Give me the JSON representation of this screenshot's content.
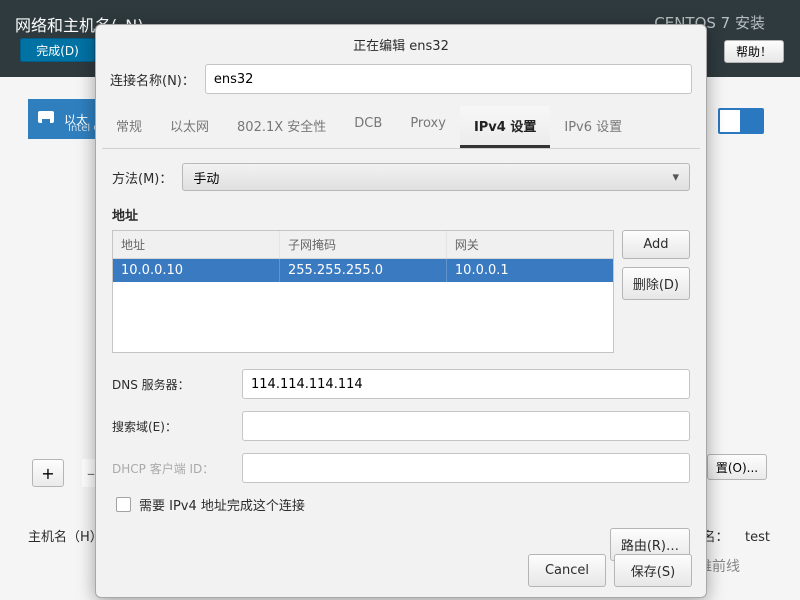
{
  "bg": {
    "title": "网络和主机名(_N)",
    "centos": "CENTOS 7 安装",
    "done": "完成(D)",
    "help": "帮助！",
    "eth_label": "以太",
    "eth_sub": "Intel C",
    "plus": "+",
    "minus": "–",
    "cfg": "置(O)...",
    "host_label": "主机名（H）",
    "host_right_label": "名：",
    "host_right_value": "test"
  },
  "modal": {
    "title_prefix": "正在编辑",
    "conn_label": "连接名称(N)：",
    "conn_value": "ens32",
    "tabs": [
      "常规",
      "以太网",
      "802.1X 安全性",
      "DCB",
      "Proxy",
      "IPv4 设置",
      "IPv6 设置"
    ],
    "active_tab": 5,
    "method_label": "方法(M)：",
    "method_value": "手动",
    "addr_heading": "地址",
    "addr_cols": [
      "地址",
      "子网掩码",
      "网关"
    ],
    "addr_rows": [
      {
        "addr": "10.0.0.10",
        "mask": "255.255.255.0",
        "gw": "10.0.0.1"
      }
    ],
    "btn_add": "Add",
    "btn_del": "删除(D)",
    "dns_label": "DNS 服务器：",
    "dns_value": "114.114.114.114",
    "search_label": "搜索域(E)：",
    "search_value": "",
    "dhcp_label": "DHCP 客户端 ID：",
    "dhcp_value": "",
    "require_label": "需要 IPv4 地址完成这个连接",
    "routes_btn": "路由(R)…",
    "cancel_btn": "Cancel",
    "save_btn": "保存(S)"
  },
  "watermark": "IT运维前线"
}
